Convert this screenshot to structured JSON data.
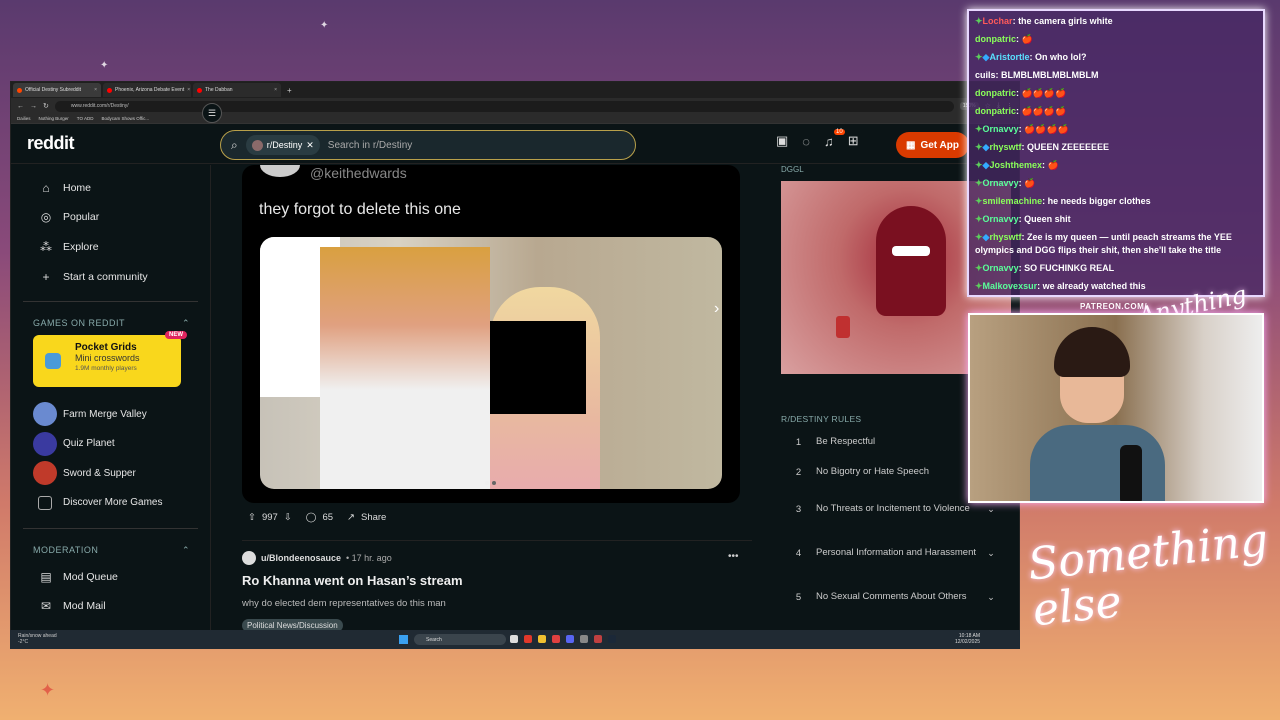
{
  "browser": {
    "tabs": [
      {
        "label": "Official Destiny Subreddit",
        "active": true
      },
      {
        "label": "Phoenix, Arizona Debate Event",
        "active": false
      },
      {
        "label": "The Dabban",
        "active": false
      }
    ],
    "url": "www.reddit.com/r/Destiny/",
    "zoom": "150%",
    "bookmarks": [
      "Dailies",
      "Nothing Burger",
      "TO ADD",
      "Bodycam Shows Offic..."
    ]
  },
  "reddit": {
    "logo": "reddit",
    "search": {
      "chip": "r/Destiny",
      "placeholder": "Search in r/Destiny"
    },
    "notif_count": "10",
    "get_app": "Get App",
    "nav": [
      {
        "label": "Home",
        "icon": "home-icon"
      },
      {
        "label": "Popular",
        "icon": "popular-icon"
      },
      {
        "label": "Explore",
        "icon": "explore-icon"
      },
      {
        "label": "Start a community",
        "icon": "plus-icon"
      }
    ],
    "games_section": "GAMES ON REDDIT",
    "pocket": {
      "title": "Pocket Grids",
      "subtitle": "Mini crosswords",
      "meta": "1.9M monthly players",
      "badge": "NEW"
    },
    "games": [
      {
        "label": "Farm Merge Valley",
        "color": "#6a8ad0"
      },
      {
        "label": "Quiz Planet",
        "color": "#3a3aa0"
      },
      {
        "label": "Sword & Supper",
        "color": "#c03a2a"
      },
      {
        "label": "Discover More Games",
        "color": "#0b1416"
      }
    ],
    "moderation_section": "MODERATION",
    "mod": [
      {
        "label": "Mod Queue",
        "icon": "mod-queue-icon"
      },
      {
        "label": "Mod Mail",
        "icon": "mail-icon"
      }
    ],
    "post": {
      "handle": "@keithedwards",
      "text": "they forgot to delete this one",
      "votes": "997",
      "comments": "65",
      "share": "Share"
    },
    "post2": {
      "user": "u/Blondeenosauce",
      "time": "• 17 hr. ago",
      "title": "Ro Khanna went on Hasan’s stream",
      "body": "why do elected dem representatives do this man",
      "flair": "Political News/Discussion"
    },
    "right": {
      "widget_label": "DGGL",
      "rules_title": "R/DESTINY RULES",
      "rules": [
        {
          "n": "1",
          "text": "Be Respectful",
          "chevron": false
        },
        {
          "n": "2",
          "text": "No Bigotry or Hate Speech",
          "chevron": false
        },
        {
          "n": "3",
          "text": "No Threats or Incitement to Violence",
          "chevron": true
        },
        {
          "n": "4",
          "text": "Personal Information and Harassment",
          "chevron": true
        },
        {
          "n": "5",
          "text": "No Sexual Comments About Others",
          "chevron": true
        }
      ]
    }
  },
  "taskbar": {
    "weather": "Rain/snow ahead",
    "temp": "-2°C",
    "search": "Search",
    "time": "10:18 AM",
    "date": "12/02/2025"
  },
  "chat": [
    {
      "user": "Lochar",
      "color": "#ff5a5a",
      "text": "the camera girls white",
      "badge": "g"
    },
    {
      "user": "donpatric",
      "color": "#8aff5a",
      "text": "🍎",
      "badge": ""
    },
    {
      "user": "Aristortle",
      "color": "#5ae0ff",
      "text": "On who lol?",
      "badge": "gb"
    },
    {
      "user": "cuils",
      "color": "#ffffff",
      "text": "BLMBLMBLMBLMBLM",
      "badge": ""
    },
    {
      "user": "donpatric",
      "color": "#8aff5a",
      "text": "🍎🍎🍎🍎",
      "badge": ""
    },
    {
      "user": "donpatric",
      "color": "#8aff5a",
      "text": "🍎🍎🍎🍎",
      "badge": ""
    },
    {
      "user": "Ornavvy",
      "color": "#5aff9a",
      "text": "🍎🍎🍎🍎",
      "badge": "g"
    },
    {
      "user": "rhyswtf",
      "color": "#8aff5a",
      "text": "QUEEN ZEEEEEEE",
      "badge": "gb"
    },
    {
      "user": "Joshthemex",
      "color": "#8aff5a",
      "text": "🍎",
      "badge": "gb"
    },
    {
      "user": "Ornavvy",
      "color": "#5aff9a",
      "text": "🍎",
      "badge": "g"
    },
    {
      "user": "smilemachine",
      "color": "#8aff5a",
      "text": "he needs bigger clothes",
      "badge": "g"
    },
    {
      "user": "Ornavvy",
      "color": "#5aff9a",
      "text": "Queen shit",
      "badge": "g"
    },
    {
      "user": "rhyswtf",
      "color": "#8aff5a",
      "text": "Zee is my queen — until peach streams the YEE olympics and DGG flips their shit, then she'll take the title",
      "badge": "gb"
    },
    {
      "user": "Ornavvy",
      "color": "#5aff9a",
      "text": "SO FUCHINKG REAL",
      "badge": "g"
    },
    {
      "user": "Malkovexsur",
      "color": "#5aff9a",
      "text": "we already watched this",
      "badge": "g"
    }
  ],
  "overlay": {
    "patreon": "PATREON.COM/",
    "brand_top": "Anything else?",
    "brand_bottom": "Something else"
  }
}
